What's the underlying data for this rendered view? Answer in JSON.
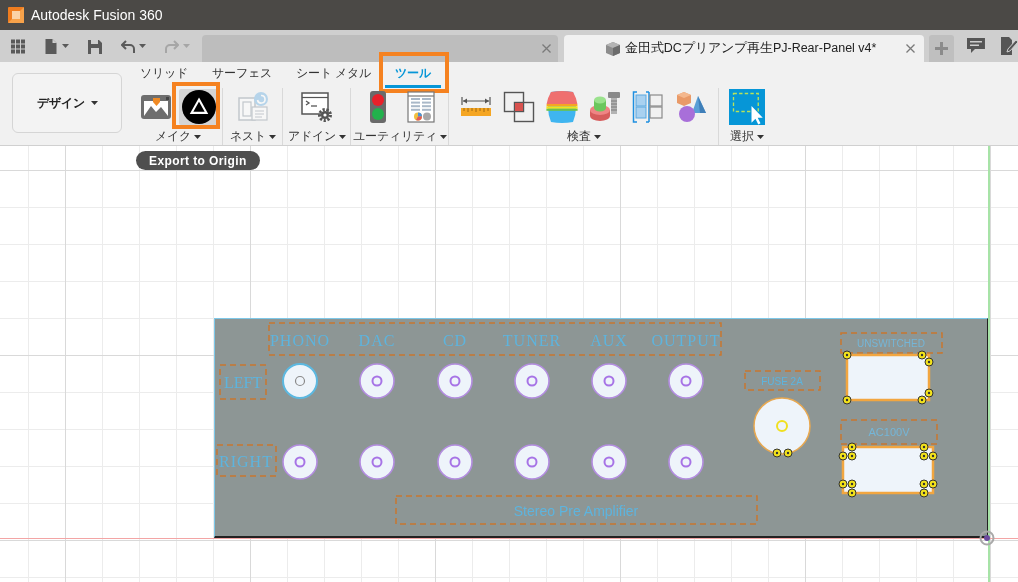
{
  "window": {
    "title": "Autodesk Fusion 360"
  },
  "quick_access": [
    {
      "kind": "apps",
      "disabled": false
    },
    {
      "kind": "file",
      "disabled": false
    },
    {
      "kind": "save",
      "disabled": false
    },
    {
      "kind": "undo",
      "disabled": false
    },
    {
      "kind": "redo",
      "disabled": true
    }
  ],
  "document_tabs": [
    {
      "selected": false
    },
    {
      "title": "金田式DCプリアンプ再生PJ-Rear-Panel v4*",
      "selected": true
    }
  ],
  "workspace": {
    "label": "デザイン"
  },
  "toolbar_tabs": [
    {
      "label": "ソリッド",
      "selected": false,
      "highlighted": false
    },
    {
      "label": "サーフェス",
      "selected": false,
      "highlighted": false
    },
    {
      "label": "シート メタル",
      "selected": false,
      "highlighted": false
    },
    {
      "label": "ツール",
      "selected": true,
      "highlighted": true
    }
  ],
  "tool_groups": [
    {
      "label": "メイク",
      "tools": [
        {
          "kind": "make",
          "hovered": false,
          "highlighted": false,
          "disabled": false
        },
        {
          "kind": "export",
          "hovered": true,
          "highlighted": true,
          "disabled": false
        }
      ]
    },
    {
      "label": "ネスト",
      "tools": [
        {
          "kind": "nest",
          "hovered": false,
          "highlighted": false,
          "disabled": true
        }
      ]
    },
    {
      "label": "アドイン",
      "tools": [
        {
          "kind": "addin",
          "hovered": false,
          "highlighted": false,
          "disabled": false
        }
      ]
    },
    {
      "label": "ユーティリティ",
      "tools": [
        {
          "kind": "status",
          "hovered": false,
          "highlighted": false,
          "disabled": false
        },
        {
          "kind": "table",
          "hovered": false,
          "highlighted": false,
          "disabled": false
        }
      ]
    },
    {
      "label": "検査",
      "tools": [
        {
          "kind": "measure",
          "hovered": false,
          "highlighted": false,
          "disabled": false
        },
        {
          "kind": "interference",
          "hovered": false,
          "highlighted": false,
          "disabled": false
        },
        {
          "kind": "zebra",
          "hovered": false,
          "highlighted": false,
          "disabled": false
        },
        {
          "kind": "draft",
          "hovered": false,
          "highlighted": false,
          "disabled": false
        },
        {
          "kind": "section",
          "hovered": false,
          "highlighted": false,
          "disabled": false
        },
        {
          "kind": "component",
          "hovered": false,
          "highlighted": false,
          "disabled": false
        }
      ]
    },
    {
      "label": "選択",
      "tools": [
        {
          "kind": "select",
          "hovered": false,
          "highlighted": false,
          "disabled": false
        }
      ]
    }
  ],
  "tooltip": {
    "text": "Export to Origin"
  },
  "panel": {
    "input_labels": [
      "PHONO",
      "DAC",
      "CD",
      "TUNER",
      "AUX",
      "OUTPUT"
    ],
    "channels": [
      {
        "label": "LEFT",
        "jacks": [
          {
            "hovered": true
          },
          {
            "hovered": false
          },
          {
            "hovered": false
          },
          {
            "hovered": false
          },
          {
            "hovered": false
          },
          {
            "hovered": false
          }
        ]
      },
      {
        "label": "RIGHT",
        "jacks": [
          {
            "hovered": false
          },
          {
            "hovered": false
          },
          {
            "hovered": false
          },
          {
            "hovered": false
          },
          {
            "hovered": false
          },
          {
            "hovered": false
          }
        ]
      }
    ],
    "title": "Stereo Pre Amplifier",
    "fuse": {
      "label": "FUSE 2A"
    },
    "outlets": [
      {
        "label": "UNSWITCHED"
      },
      {
        "label": "AC100V"
      }
    ]
  }
}
